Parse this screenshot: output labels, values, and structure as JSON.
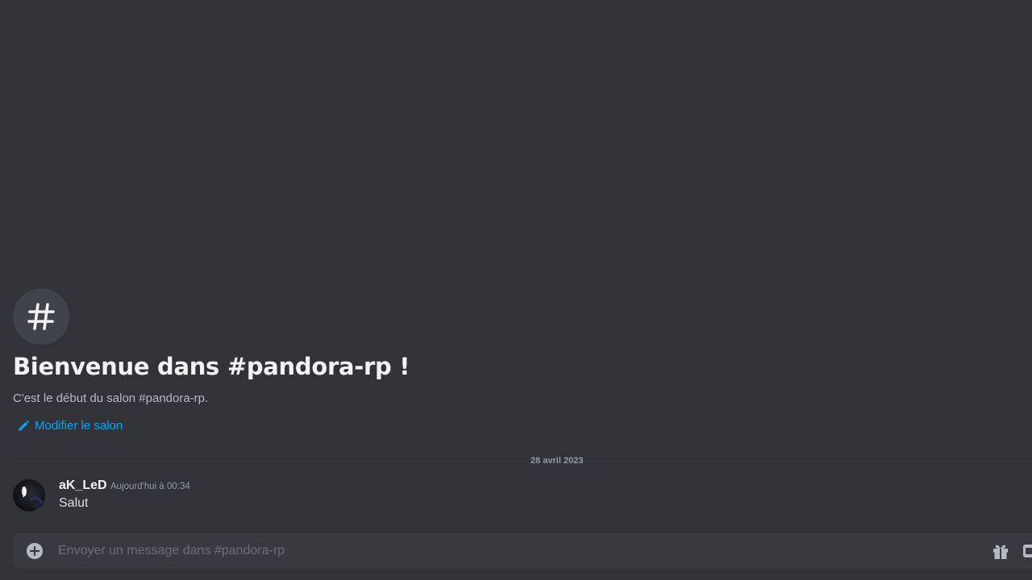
{
  "channel": {
    "welcome_title": "Bienvenue dans #pandora-rp !",
    "welcome_subtitle": "C'est le début du salon #pandora-rp.",
    "edit_link_label": "Modifier le salon",
    "icon": "hash-icon"
  },
  "divider": {
    "date_label": "28 avril 2023"
  },
  "messages": [
    {
      "author": "aK_LeD",
      "timestamp": "Aujourd'hui à 00:34",
      "text": "Salut"
    }
  ],
  "composer": {
    "placeholder": "Envoyer un message dans #pandora-rp",
    "add_icon": "plus-circle-icon",
    "gift_icon": "gift-icon",
    "extra_icon": "gif-icon"
  },
  "colors": {
    "background": "#313338",
    "link": "#00a8fc",
    "composer": "#383a40"
  }
}
